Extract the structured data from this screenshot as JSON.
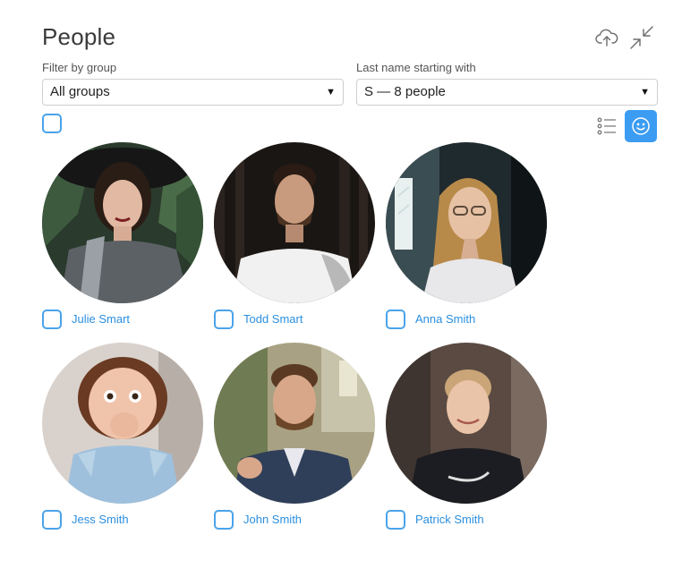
{
  "header": {
    "title": "People",
    "upload_icon": "cloud-upload-icon",
    "collapse_icon": "collapse-arrows-icon"
  },
  "filters": {
    "group_label": "Filter by group",
    "group_value": "All groups",
    "lastname_label": "Last name starting with",
    "lastname_value": "S — 8 people"
  },
  "view": {
    "list_icon": "list-view-icon",
    "grid_icon": "face-grid-view-icon",
    "active": "grid"
  },
  "colors": {
    "accent": "#3b9cf2",
    "link": "#2b8fe0",
    "checkbox_border": "#4aa3ea"
  },
  "people": [
    {
      "name": "Julie Smart"
    },
    {
      "name": "Todd Smart"
    },
    {
      "name": "Anna Smith"
    },
    {
      "name": "Jess Smith"
    },
    {
      "name": "John Smith"
    },
    {
      "name": "Patrick Smith"
    }
  ]
}
